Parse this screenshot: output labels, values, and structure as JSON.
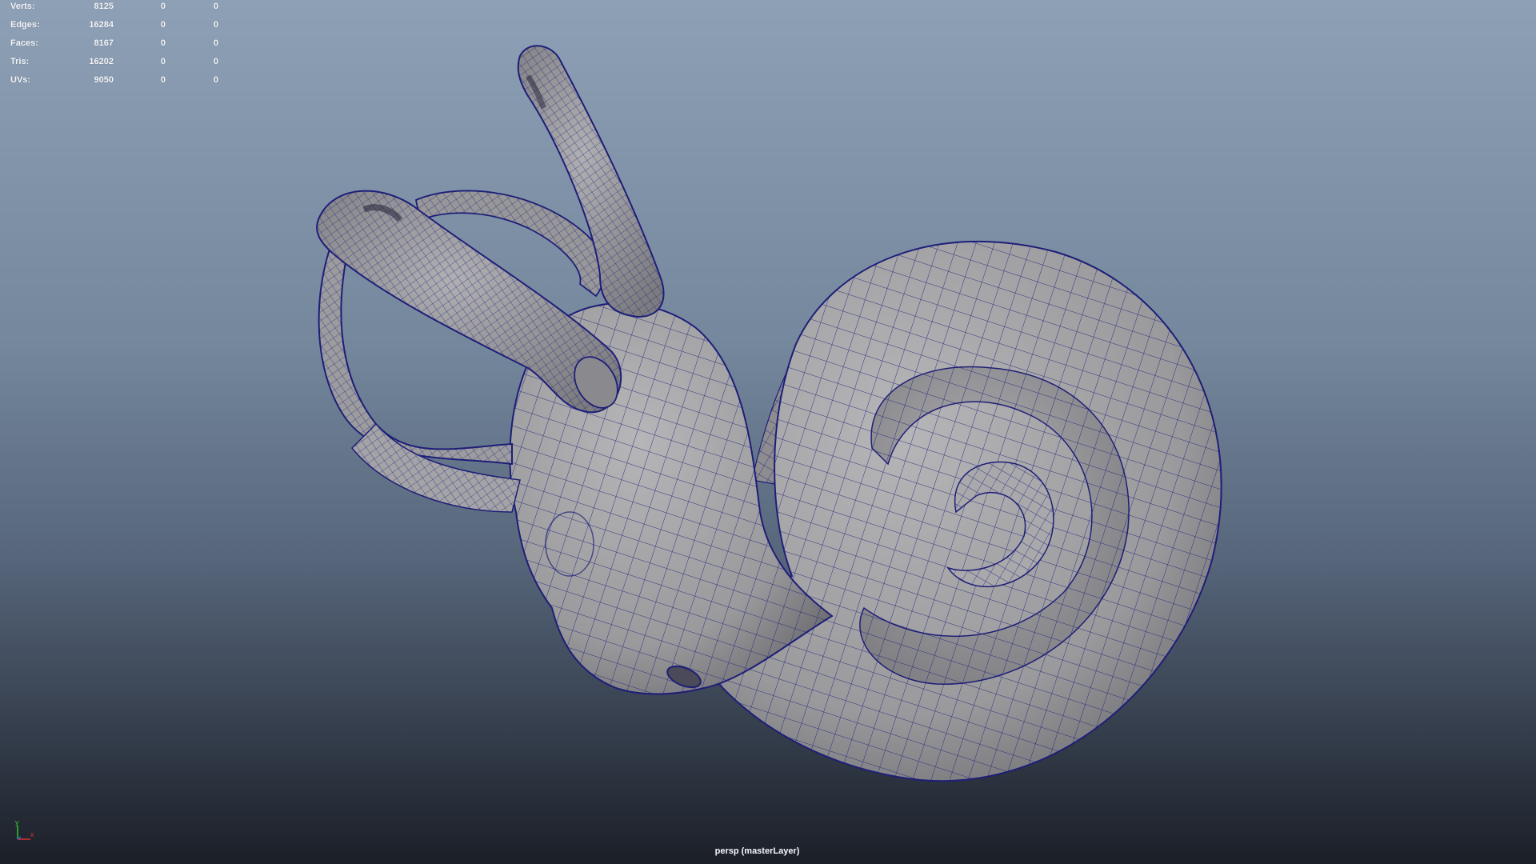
{
  "hud": {
    "rows": [
      {
        "label": "Verts:",
        "values": [
          "8125",
          "0",
          "0"
        ]
      },
      {
        "label": "Edges:",
        "values": [
          "16284",
          "0",
          "0"
        ]
      },
      {
        "label": "Faces:",
        "values": [
          "8167",
          "0",
          "0"
        ]
      },
      {
        "label": "Tris:",
        "values": [
          "16202",
          "0",
          "0"
        ]
      },
      {
        "label": "UVs:",
        "values": [
          "9050",
          "0",
          "0"
        ]
      }
    ]
  },
  "camera_label": "persp (masterLayer)",
  "axis_gizmo": {
    "y_label": "y",
    "x_label": "x"
  },
  "colors": {
    "background_top": "#8ea0b6",
    "background_bottom": "#1b1f27",
    "mesh_fill": "#9b9b9e",
    "wire": "#1e1e78",
    "hud_text": "#f4f6fa",
    "axis_x": "#d83030",
    "axis_y": "#30c030",
    "axis_z": "#3060e0"
  }
}
